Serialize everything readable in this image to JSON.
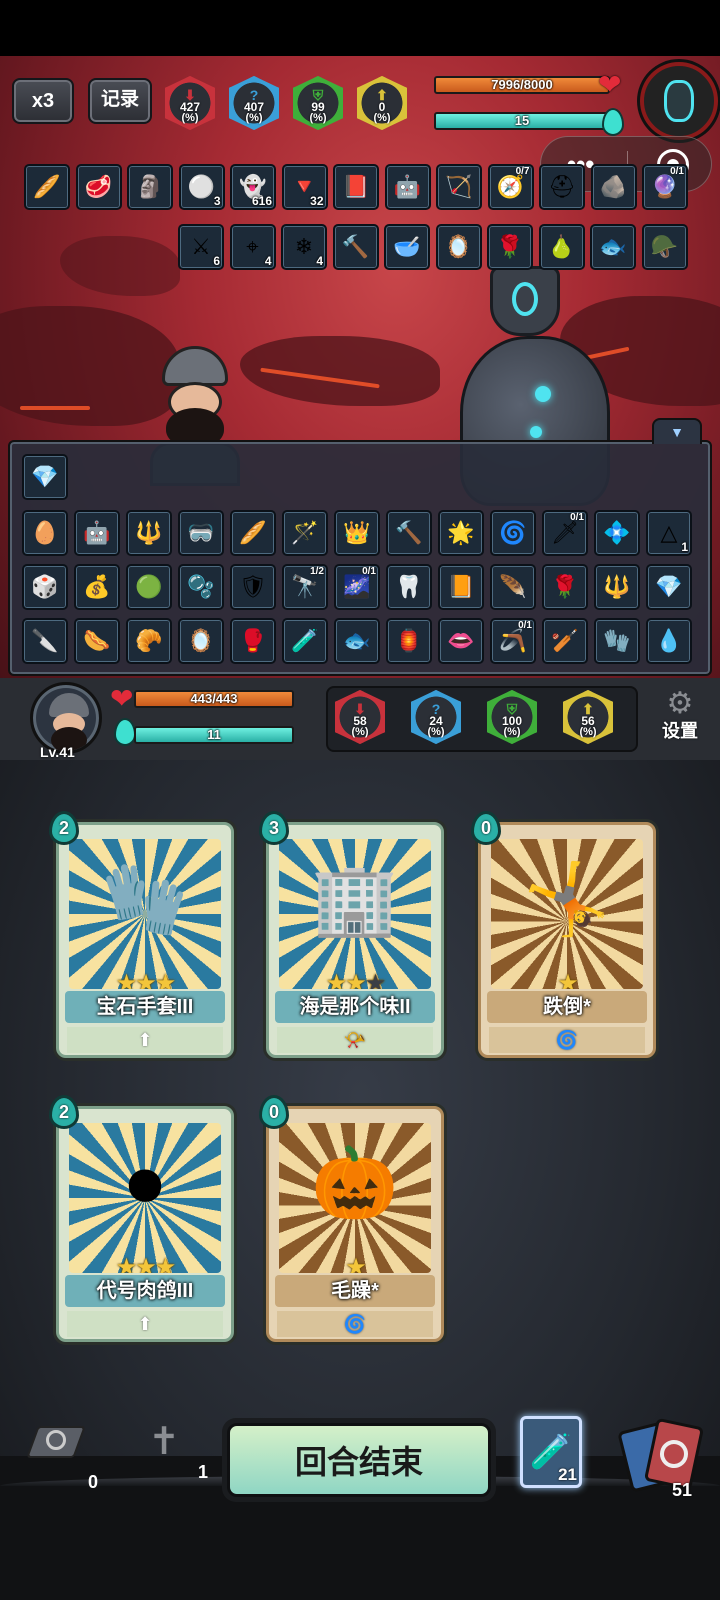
{
  "top_bar": {
    "speed_label": "x3",
    "log_label": "记录"
  },
  "enemy": {
    "stats": [
      {
        "value": "427",
        "unit": "(%)",
        "icon": "red-arrow-down-icon",
        "color": "#c8323c",
        "glyph": "⬇"
      },
      {
        "value": "407",
        "unit": "(%)",
        "icon": "question-icon",
        "color": "#3a9fd8",
        "glyph": "?"
      },
      {
        "value": "99",
        "unit": "(%)",
        "icon": "green-shield-icon",
        "color": "#3faf3a",
        "glyph": "⛨"
      },
      {
        "value": "0",
        "unit": "(%)",
        "icon": "yellow-arrow-up-icon",
        "color": "#d9c23a",
        "glyph": "⬆"
      }
    ],
    "hp_text": "7996/8000",
    "hp_fraction": 0.9995,
    "energy_text": "15",
    "energy_fraction": 1.0
  },
  "enemy_items_row1": [
    {
      "icon": "baguette-icon",
      "glyph": "🥖"
    },
    {
      "icon": "meat-icon",
      "glyph": "🥩"
    },
    {
      "icon": "golem-icon",
      "glyph": "🗿"
    },
    {
      "icon": "snowball-icon",
      "glyph": "⚪",
      "badge": "3"
    },
    {
      "icon": "ghost-icon",
      "glyph": "👻",
      "badge": "616"
    },
    {
      "icon": "red-arrow-icon",
      "glyph": "🔻",
      "badge": "32"
    },
    {
      "icon": "book-icon",
      "glyph": "📕"
    },
    {
      "icon": "robot-icon",
      "glyph": "🤖"
    },
    {
      "icon": "crossbow-icon",
      "glyph": "🏹"
    },
    {
      "icon": "compass-icon",
      "glyph": "🧭",
      "frac": "0/7"
    },
    {
      "icon": "helmet-icon",
      "glyph": "⛑"
    },
    {
      "icon": "stone-icon",
      "glyph": "🪨"
    },
    {
      "icon": "orb-icon",
      "glyph": "🔮",
      "frac": "0/1"
    }
  ],
  "enemy_items_row2": [
    {
      "icon": "claw-slash-icon",
      "glyph": "⚔",
      "badge": "6"
    },
    {
      "icon": "crosshair-icon",
      "glyph": "⌖",
      "badge": "4"
    },
    {
      "icon": "snowflake-icon",
      "glyph": "❄",
      "badge": "4"
    },
    {
      "icon": "hammer-icon",
      "glyph": "🔨"
    },
    {
      "icon": "bowl-icon",
      "glyph": "🥣"
    },
    {
      "icon": "mirror-icon",
      "glyph": "🪞"
    },
    {
      "icon": "rose-icon",
      "glyph": "🌹"
    },
    {
      "icon": "gourd-icon",
      "glyph": "🍐"
    },
    {
      "icon": "fish-icon",
      "glyph": "🐟"
    },
    {
      "icon": "helmet-gold-icon",
      "glyph": "🪖"
    }
  ],
  "inventory": {
    "special": {
      "icon": "crystal-cluster-icon",
      "glyph": "💎"
    },
    "rows": [
      [
        {
          "icon": "easter-egg-icon",
          "glyph": "🥚"
        },
        {
          "icon": "red-robot-icon",
          "glyph": "🤖"
        },
        {
          "icon": "mace-icon",
          "glyph": "🔱"
        },
        {
          "icon": "goggles-icon",
          "glyph": "🥽"
        },
        {
          "icon": "baguette-icon",
          "glyph": "🥖"
        },
        {
          "icon": "wand-icon",
          "glyph": "🪄"
        },
        {
          "icon": "crown-spikes-icon",
          "glyph": "👑"
        },
        {
          "icon": "hammer-icon",
          "glyph": "🔨"
        },
        {
          "icon": "spark-orb-icon",
          "glyph": "🌟"
        },
        {
          "icon": "blue-rune-icon",
          "glyph": "🌀"
        },
        {
          "icon": "blade-icon",
          "glyph": "🗡",
          "frac": "0/1"
        },
        {
          "icon": "dark-gem-icon",
          "glyph": "💠"
        },
        {
          "icon": "triforce-icon",
          "glyph": "△",
          "badge": "1"
        }
      ],
      [
        {
          "icon": "cube-icon",
          "glyph": "🎲"
        },
        {
          "icon": "sack-icon",
          "glyph": "💰"
        },
        {
          "icon": "green-swirl-icon",
          "glyph": "🟢"
        },
        {
          "icon": "orb-bag-icon",
          "glyph": "🫧"
        },
        {
          "icon": "shield-round-icon",
          "glyph": "🛡"
        },
        {
          "icon": "binoculars-icon",
          "glyph": "🔭",
          "frac": "1/2"
        },
        {
          "icon": "galaxy-icon",
          "glyph": "🌌",
          "frac": "0/1"
        },
        {
          "icon": "horn-icon",
          "glyph": "🦷"
        },
        {
          "icon": "fire-tome-icon",
          "glyph": "📙"
        },
        {
          "icon": "feather-icon",
          "glyph": "🪶"
        },
        {
          "icon": "rose-icon",
          "glyph": "🌹"
        },
        {
          "icon": "trident-icon",
          "glyph": "🔱"
        },
        {
          "icon": "crystal-icon",
          "glyph": "💎"
        }
      ],
      [
        {
          "icon": "dagger-icon",
          "glyph": "🔪"
        },
        {
          "icon": "sausage-icon",
          "glyph": "🌭"
        },
        {
          "icon": "bread-icon",
          "glyph": "🥐"
        },
        {
          "icon": "mirror-icon",
          "glyph": "🪞"
        },
        {
          "icon": "boxing-glove-icon",
          "glyph": "🥊"
        },
        {
          "icon": "potion-icon",
          "glyph": "🧪"
        },
        {
          "icon": "fish-icon",
          "glyph": "🐟"
        },
        {
          "icon": "lantern-icon",
          "glyph": "🏮"
        },
        {
          "icon": "lips-icon",
          "glyph": "👄"
        },
        {
          "icon": "boomerang-icon",
          "glyph": "🪃",
          "frac": "0/1"
        },
        {
          "icon": "club-icon",
          "glyph": "🏏"
        },
        {
          "icon": "glove-icon",
          "glyph": "🧤"
        },
        {
          "icon": "water-orb-icon",
          "glyph": "💧"
        }
      ]
    ]
  },
  "player": {
    "level": "Lv.41",
    "hp_text": "443/443",
    "hp_fraction": 1.0,
    "energy_text": "11",
    "energy_fraction": 1.0,
    "stats": [
      {
        "value": "58",
        "unit": "(%)",
        "icon": "red-arrow-down-icon",
        "color": "#c8323c",
        "glyph": "⬇"
      },
      {
        "value": "24",
        "unit": "(%)",
        "icon": "question-icon",
        "color": "#3a9fd8",
        "glyph": "?"
      },
      {
        "value": "100",
        "unit": "(%)",
        "icon": "green-shield-icon",
        "color": "#3faf3a",
        "glyph": "⛨"
      },
      {
        "value": "56",
        "unit": "(%)",
        "icon": "yellow-arrow-up-icon",
        "color": "#d9c23a",
        "glyph": "⬆"
      }
    ],
    "settings_label": "设置"
  },
  "cards": [
    {
      "cost": "2",
      "name": "宝石手套III",
      "stars": 3,
      "max_stars": 3,
      "type": "upgrade-arrow",
      "art_glyph": "🧤",
      "tone": "skill"
    },
    {
      "cost": "3",
      "name": "海是那个味II",
      "stars": 2,
      "max_stars": 3,
      "type": "whistle",
      "art_glyph": "🏢",
      "tone": "skill"
    },
    {
      "cost": "0",
      "name": "跌倒*",
      "stars": 1,
      "max_stars": 1,
      "type": "spiral",
      "art_glyph": "🤸",
      "tone": "status"
    },
    {
      "cost": "2",
      "name": "代号肉鸽III",
      "stars": 3,
      "max_stars": 3,
      "type": "upgrade-arrow",
      "art_glyph": "⏺",
      "tone": "skill"
    },
    {
      "cost": "0",
      "name": "毛躁*",
      "stars": 1,
      "max_stars": 1,
      "type": "spiral",
      "art_glyph": "🎃",
      "tone": "status"
    }
  ],
  "bottom": {
    "discard_count": "0",
    "grave_count": "1",
    "end_turn_label": "回合结束",
    "potion_count": "21",
    "deck_count": "51"
  }
}
